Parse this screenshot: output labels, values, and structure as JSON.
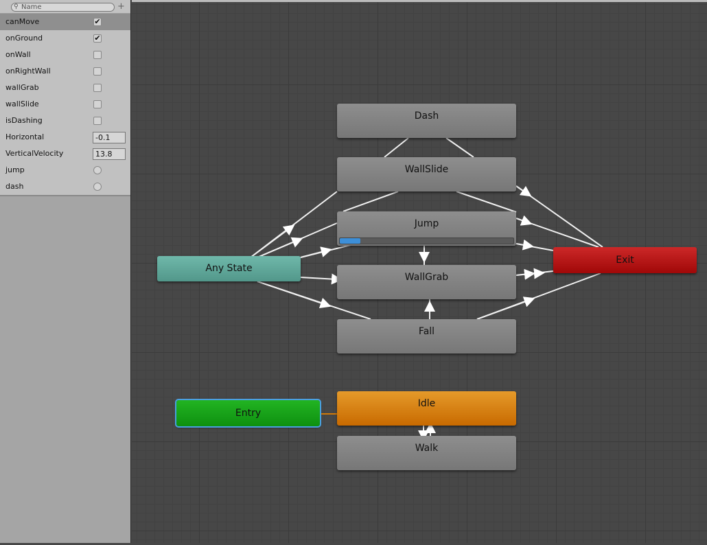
{
  "parameters": {
    "search_placeholder": "Name",
    "items": [
      {
        "name": "canMove",
        "type": "bool",
        "value": true
      },
      {
        "name": "onGround",
        "type": "bool",
        "value": true
      },
      {
        "name": "onWall",
        "type": "bool",
        "value": false
      },
      {
        "name": "onRightWall",
        "type": "bool",
        "value": false
      },
      {
        "name": "wallGrab",
        "type": "bool",
        "value": false
      },
      {
        "name": "wallSlide",
        "type": "bool",
        "value": false
      },
      {
        "name": "isDashing",
        "type": "bool",
        "value": false
      },
      {
        "name": "Horizontal",
        "type": "float",
        "value": "-0.1"
      },
      {
        "name": "VerticalVelocity",
        "type": "float",
        "value": "13.8"
      },
      {
        "name": "jump",
        "type": "trigger"
      },
      {
        "name": "dash",
        "type": "trigger"
      }
    ]
  },
  "states": {
    "dash": "Dash",
    "wallslide": "WallSlide",
    "jump": "Jump",
    "wallgrab": "WallGrab",
    "fall": "Fall",
    "anystate": "Any State",
    "exit": "Exit",
    "entry": "Entry",
    "idle": "Idle",
    "walk": "Walk"
  },
  "jump_progress": 0.12,
  "colors": {
    "anystate": "#5fa89a",
    "exit": "#b01010",
    "entry": "#14a014",
    "idle": "#d27a0a",
    "progress": "#3d8fd8"
  }
}
